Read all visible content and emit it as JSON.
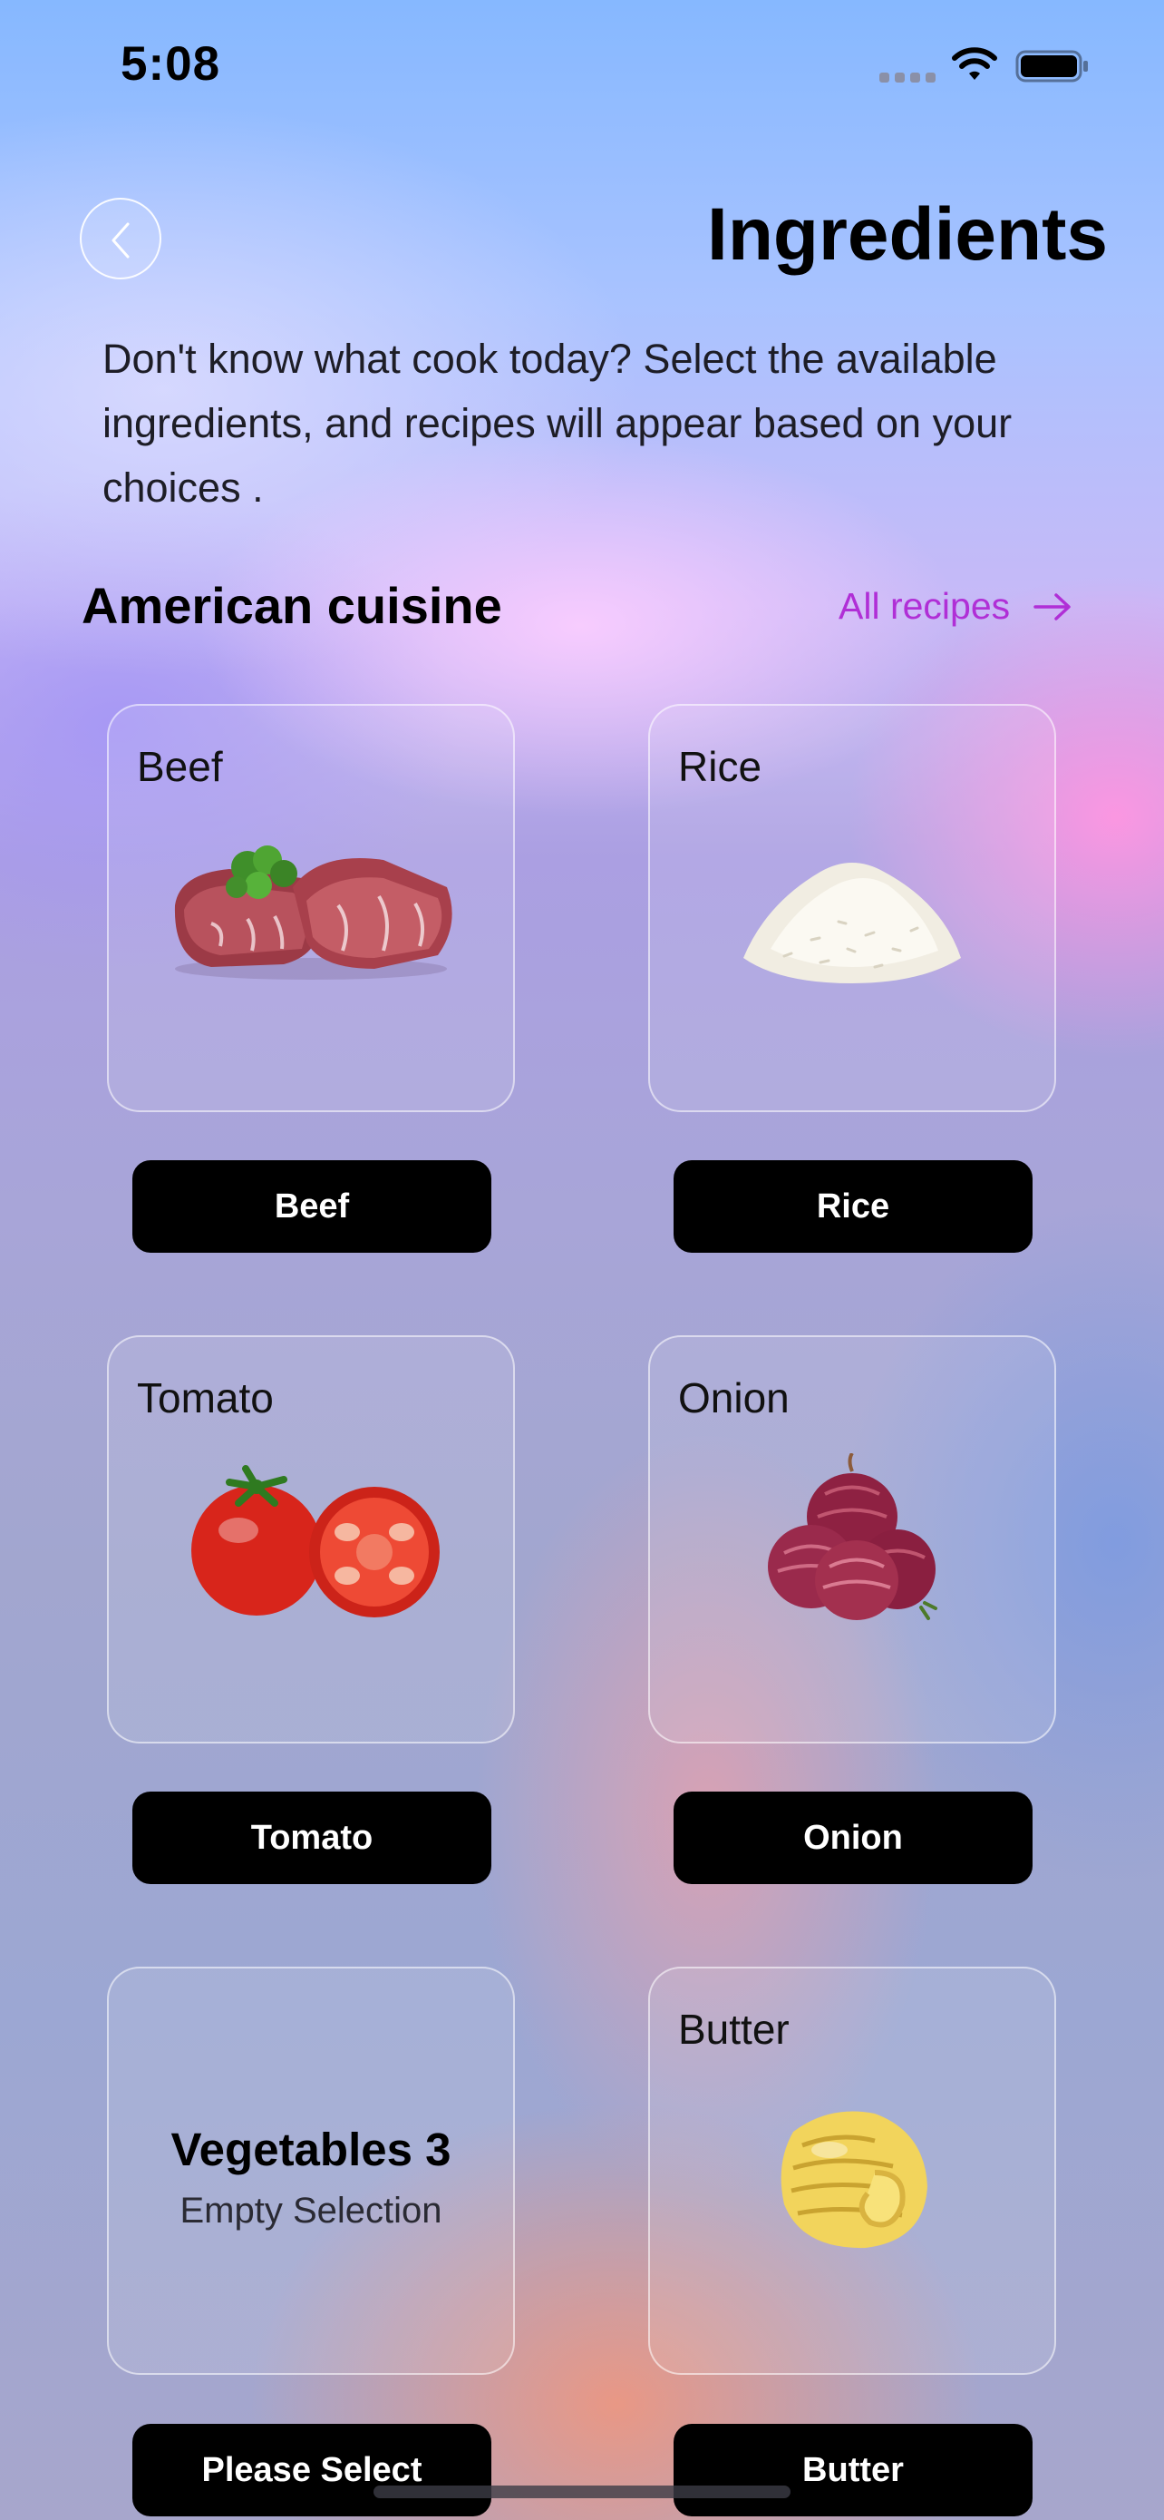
{
  "status_bar": {
    "time": "5:08"
  },
  "header": {
    "back_icon": "chevron-left-icon",
    "title": "Ingredients"
  },
  "intro": {
    "text": "Don't know what cook today? Select the available ingredients, and recipes will appear based on your choices ."
  },
  "section": {
    "title": "American cuisine",
    "link_label": "All recipes",
    "link_icon": "arrow-right-icon",
    "accent_color": "#b02fd6"
  },
  "ingredients": [
    {
      "card_label": "Beef",
      "button_label": "Beef",
      "icon": "beef-icon"
    },
    {
      "card_label": "Rice",
      "button_label": "Rice",
      "icon": "rice-icon"
    },
    {
      "card_label": "Tomato",
      "button_label": "Tomato",
      "icon": "tomato-icon"
    },
    {
      "card_label": "Onion",
      "button_label": "Onion",
      "icon": "onion-icon"
    },
    {
      "card_title": "Vegetables 3",
      "card_subtitle": "Empty Selection",
      "button_label": "Please Select"
    },
    {
      "card_label": "Butter",
      "button_label": "Butter",
      "icon": "butter-icon"
    }
  ]
}
